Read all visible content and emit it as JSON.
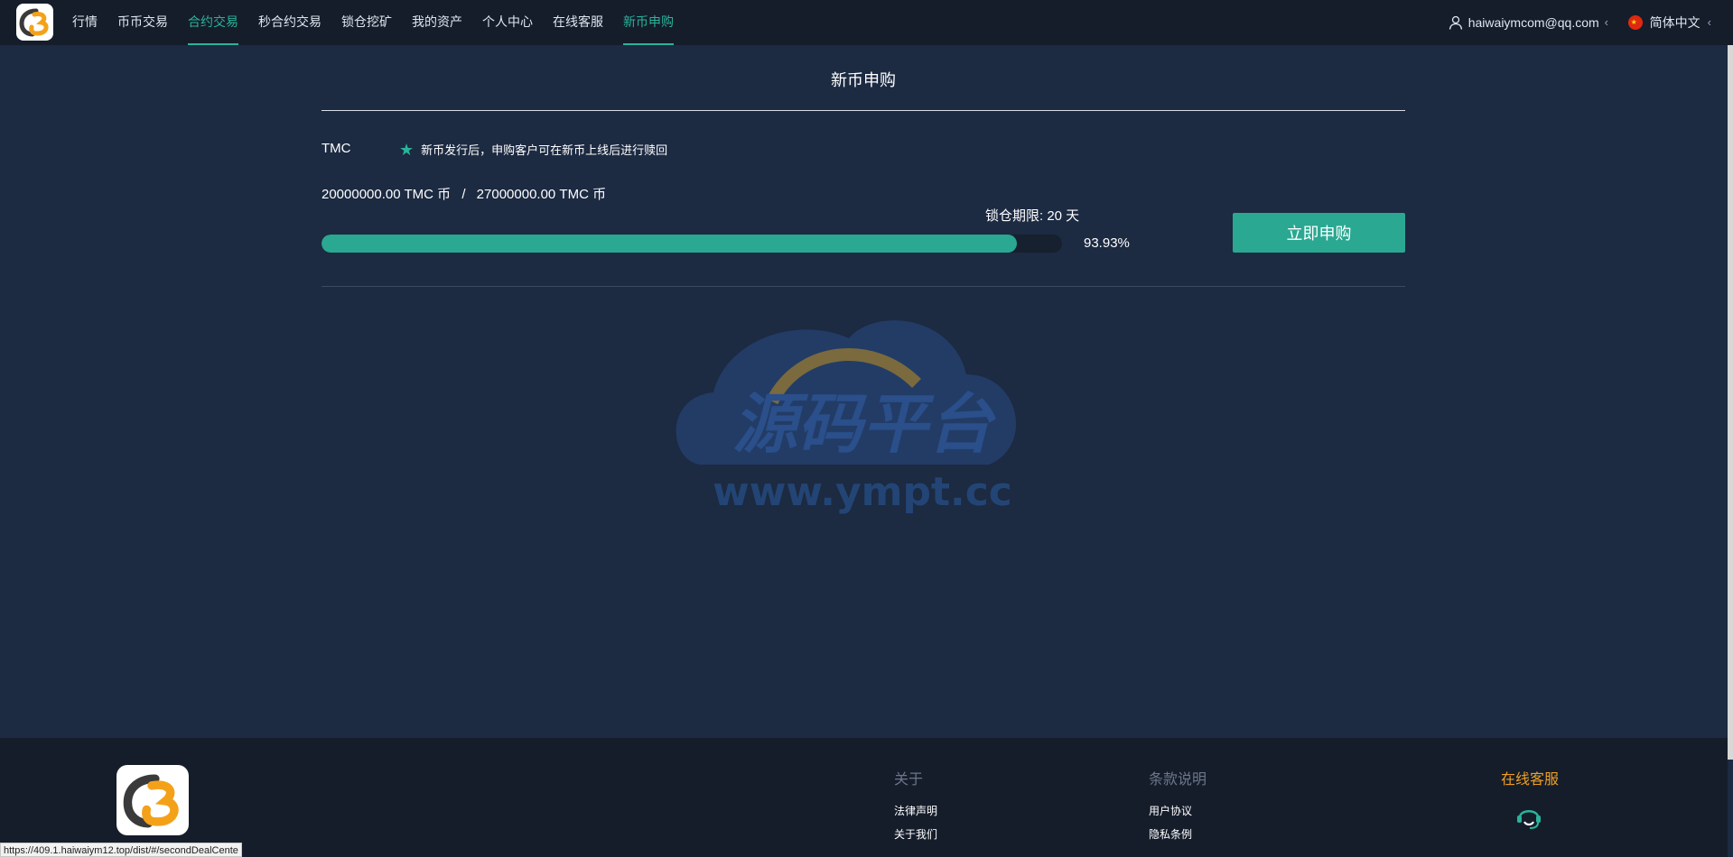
{
  "nav": {
    "items": [
      {
        "label": "行情",
        "active": false
      },
      {
        "label": "币币交易",
        "active": false
      },
      {
        "label": "合约交易",
        "active": true
      },
      {
        "label": "秒合约交易",
        "active": false
      },
      {
        "label": "锁仓挖矿",
        "active": false
      },
      {
        "label": "我的资产",
        "active": false
      },
      {
        "label": "个人中心",
        "active": false
      },
      {
        "label": "在线客服",
        "active": false
      },
      {
        "label": "新币申购",
        "active": true
      }
    ],
    "user_email": "haiwaiymcom@qq.com",
    "language": "简体中文"
  },
  "page": {
    "title": "新币申购",
    "coin": "TMC",
    "notice": "新币发行后，申购客户可在新币上线后进行赎回",
    "amount_sold": "20000000.00 TMC 币",
    "amount_separator": "/",
    "amount_total": "27000000.00 TMC 币",
    "lock_period": "锁仓期限: 20 天",
    "progress_percent_text": "93.93%",
    "progress_fraction": 0.9393,
    "buy_button": "立即申购"
  },
  "watermark": {
    "main_text": "源码平台",
    "url_text": "www.ympt.cc"
  },
  "footer": {
    "about": {
      "heading": "关于",
      "links": [
        "法律声明",
        "关于我们"
      ]
    },
    "terms": {
      "heading": "条款说明",
      "links": [
        "用户协议",
        "隐私条例"
      ]
    },
    "support": {
      "heading": "在线客服"
    }
  },
  "status_url": "https://409.1.haiwaiym12.top/dist/#/secondDealCente",
  "colors": {
    "accent": "#2ab39a",
    "background": "#1c2a42",
    "nav_background": "#151d2b",
    "support_heading": "#f0a020"
  }
}
